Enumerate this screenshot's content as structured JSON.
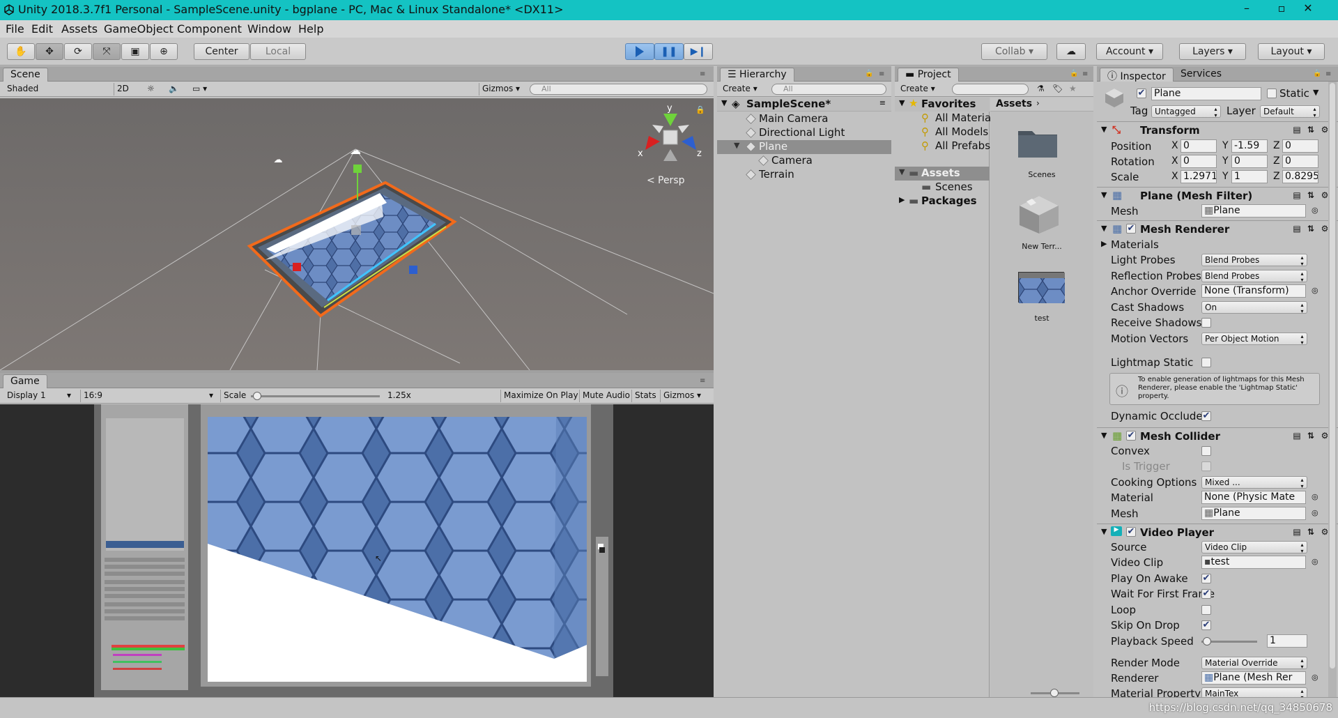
{
  "titlebar": {
    "title": "Unity 2018.3.7f1 Personal - SampleScene.unity - bgplane - PC, Mac & Linux Standalone* <DX11>",
    "minimize": "–",
    "maximize": "▫",
    "close": "✕"
  },
  "menu": [
    "File",
    "Edit",
    "Assets",
    "GameObject",
    "Component",
    "Window",
    "Help"
  ],
  "toolbar": {
    "pivot": "Center",
    "space": "Local",
    "collab": "Collab",
    "account": "Account",
    "layers": "Layers",
    "layout": "Layout"
  },
  "scene": {
    "tab": "Scene",
    "shading": "Shaded",
    "mode_2d": "2D",
    "gizmos": "Gizmos",
    "search_placeholder": "All",
    "persp": "Persp",
    "axis_x": "x",
    "axis_y": "y",
    "axis_z": "z"
  },
  "game": {
    "tab": "Game",
    "display": "Display 1",
    "aspect": "16:9",
    "scale_label": "Scale",
    "scale_value": "1.25x",
    "scale_fraction": 0.02,
    "maximize": "Maximize On Play",
    "mute": "Mute Audio",
    "stats": "Stats",
    "gizmos": "Gizmos"
  },
  "hierarchy": {
    "tab": "Hierarchy",
    "create": "Create",
    "search_placeholder": "All",
    "scene": "SampleScene*",
    "items": [
      {
        "label": "Main Camera",
        "indent": 1
      },
      {
        "label": "Directional Light",
        "indent": 1
      },
      {
        "label": "Plane",
        "indent": 1,
        "selected": true
      },
      {
        "label": "Camera",
        "indent": 2
      },
      {
        "label": "Terrain",
        "indent": 1
      }
    ]
  },
  "project": {
    "tab": "Project",
    "create": "Create",
    "favorites": "Favorites",
    "fav_items": [
      "All Materials",
      "All Models",
      "All Prefabs"
    ],
    "assets": "Assets",
    "asset_folders": [
      "Scenes"
    ],
    "packages": "Packages",
    "breadcrumb": "Assets",
    "grid_items": [
      "Scenes",
      "New Terr...",
      "test"
    ]
  },
  "inspector": {
    "tab": "Inspector",
    "tab2": "Services",
    "object_name": "Plane",
    "static_label": "Static",
    "tag_label": "Tag",
    "tag_value": "Untagged",
    "layer_label": "Layer",
    "layer_value": "Default",
    "transform": {
      "title": "Transform",
      "position_label": "Position",
      "position": [
        "0",
        "-1.59",
        "0"
      ],
      "rotation_label": "Rotation",
      "rotation": [
        "0",
        "0",
        "0"
      ],
      "scale_label": "Scale",
      "scale": [
        "1.2971",
        "1",
        "0.8295"
      ]
    },
    "mesh_filter": {
      "title": "Plane (Mesh Filter)",
      "mesh_label": "Mesh",
      "mesh_value": "Plane"
    },
    "mesh_renderer": {
      "title": "Mesh Renderer",
      "materials": "Materials",
      "light_probes_label": "Light Probes",
      "light_probes": "Blend Probes",
      "reflection_probes_label": "Reflection Probes",
      "reflection_probes": "Blend Probes",
      "anchor_override_label": "Anchor Override",
      "anchor_override": "None (Transform)",
      "cast_shadows_label": "Cast Shadows",
      "cast_shadows": "On",
      "receive_shadows_label": "Receive Shadows",
      "motion_vectors_label": "Motion Vectors",
      "motion_vectors": "Per Object Motion",
      "lightmap_static_label": "Lightmap Static",
      "info": "To enable generation of lightmaps for this Mesh Renderer, please enable the 'Lightmap Static' property.",
      "dynamic_occluded_label": "Dynamic Occluded"
    },
    "mesh_collider": {
      "title": "Mesh Collider",
      "convex_label": "Convex",
      "is_trigger_label": "Is Trigger",
      "cooking_label": "Cooking Options",
      "cooking": "Mixed ...",
      "material_label": "Material",
      "material": "None (Physic Mate",
      "mesh_label": "Mesh",
      "mesh": "Plane"
    },
    "video_player": {
      "title": "Video Player",
      "source_label": "Source",
      "source": "Video Clip",
      "clip_label": "Video Clip",
      "clip": "test",
      "play_on_awake_label": "Play On Awake",
      "wait_first_frame_label": "Wait For First Frame",
      "loop_label": "Loop",
      "skip_on_drop_label": "Skip On Drop",
      "speed_label": "Playback Speed",
      "speed": "1",
      "render_mode_label": "Render Mode",
      "render_mode": "Material Override",
      "renderer_label": "Renderer",
      "renderer": "Plane (Mesh Rer",
      "material_property_label": "Material Property",
      "material_property": "MainTex"
    }
  },
  "watermark": "https://blog.csdn.net/qq_34850678",
  "colors": {
    "titlebar": "#14c3c3",
    "selection_orange": "#f26a1b",
    "play_blue": "#1a5fb4"
  }
}
